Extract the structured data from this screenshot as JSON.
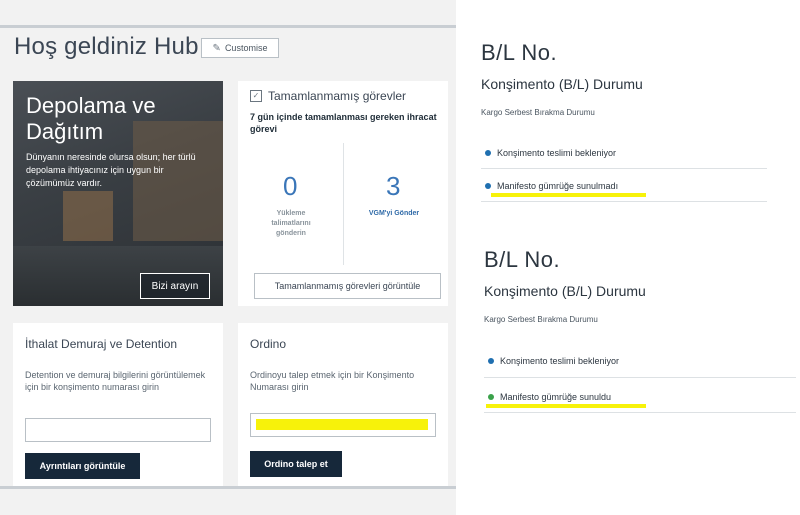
{
  "dashboard": {
    "welcome_title": "Hoş geldiniz Hub",
    "customise_label": "Customise",
    "hero": {
      "title_line1": "Depolama ve",
      "title_line2": "Dağıtım",
      "text": "Dünyanın neresinde olursa olsun; her türlü depolama ihtiyacınız için uygun bir çözümümüz vardır.",
      "button_label": "Bizi arayın"
    },
    "tasks": {
      "title": "Tamamlanmamış görevler",
      "subtitle": "7 gün içinde tamamlanması gereken ihracat görevi",
      "left_count": "0",
      "left_label": "Yükleme talimatlarını gönderin",
      "right_count": "3",
      "right_label": "VGM'yi Gönder",
      "button_label": "Tamamlanmamış görevleri görüntüle"
    },
    "import_card": {
      "title": "İthalat Demuraj ve Detention",
      "text": "Detention ve demuraj bilgilerini görüntülemek için bir konşimento numarası girin",
      "input_value": "",
      "button_label": "Ayrıntıları görüntüle"
    },
    "orders_card": {
      "title": "Ordino",
      "text": "Ordinoyu talep etmek için bir Konşimento Numarası girin",
      "input_value": "",
      "button_label": "Ordino talep et"
    }
  },
  "bl_status_top": {
    "bl_no": "B/L No.",
    "title": "Konşimento (B/L) Durumu",
    "subtitle": "Kargo Serbest Bırakma Durumu",
    "items": [
      {
        "label": "Konşimento teslimi bekleniyor",
        "dot_color": "#1f6fb0"
      },
      {
        "label": "Manifesto gümrüğe sunulmadı",
        "dot_color": "#1f6fb0"
      }
    ]
  },
  "bl_status_bottom": {
    "bl_no": "B/L No.",
    "title": "Konşimento (B/L) Durumu",
    "subtitle": "Kargo Serbest Bırakma Durumu",
    "items": [
      {
        "label": "Konşimento teslimi bekleniyor",
        "dot_color": "#1f6fb0"
      },
      {
        "label": "Manifesto gümrüğe sunuldu",
        "dot_color": "#3aa14a"
      }
    ]
  },
  "colors": {
    "highlight": "#f7f20a",
    "dark_button": "#16283a",
    "count_blue": "#3a76b8"
  }
}
